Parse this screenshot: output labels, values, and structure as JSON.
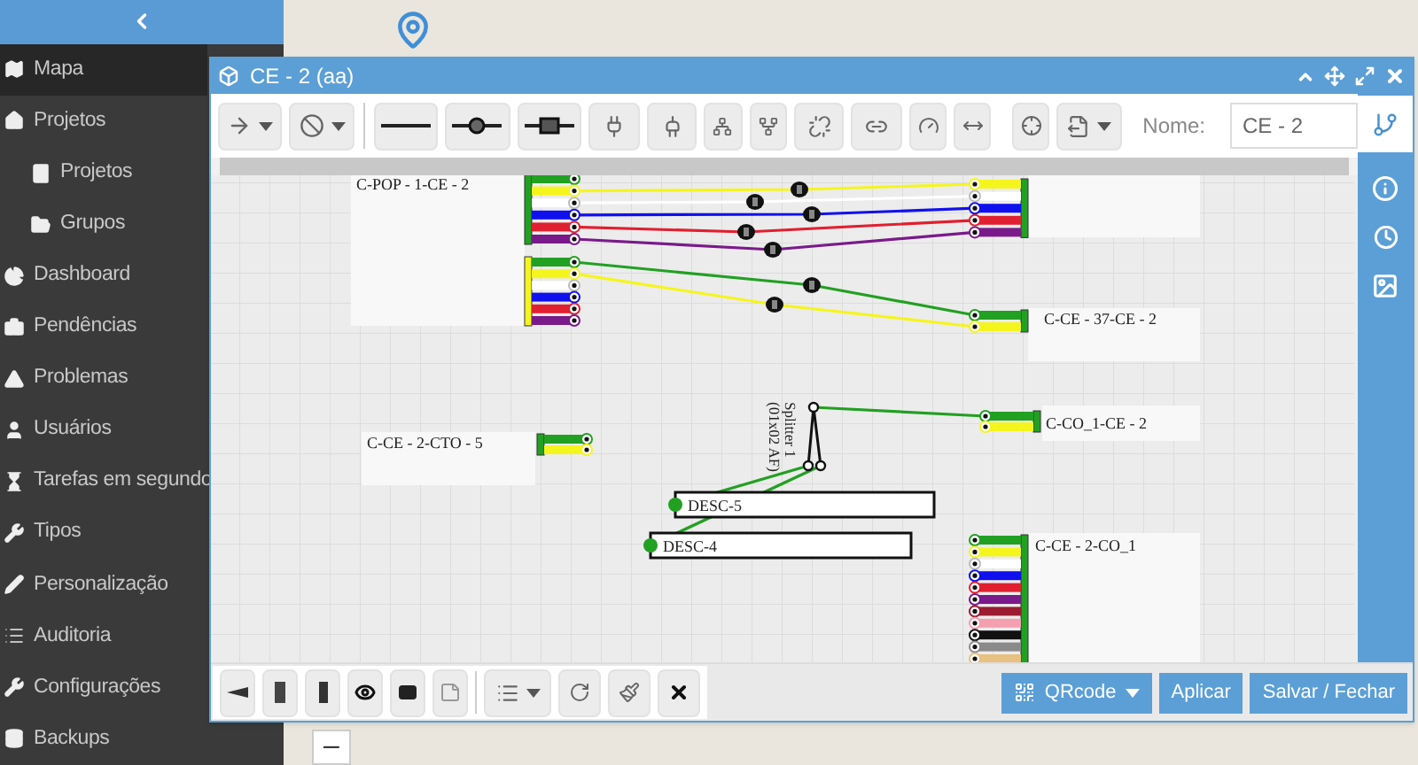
{
  "sidebar": {
    "items": [
      {
        "label": "Mapa",
        "selected": true
      },
      {
        "label": "Projetos",
        "selected": false,
        "children": [
          {
            "label": "Projetos",
            "selected": false
          },
          {
            "label": "Grupos",
            "selected": false
          }
        ]
      },
      {
        "label": "Dashboard",
        "selected": false
      },
      {
        "label": "Pendências",
        "selected": false
      },
      {
        "label": "Problemas",
        "selected": false
      },
      {
        "label": "Usuários",
        "selected": false
      },
      {
        "label": "Tarefas em segundo",
        "selected": false
      },
      {
        "label": "Tipos",
        "selected": false
      },
      {
        "label": "Personalização",
        "selected": false
      },
      {
        "label": "Auditoria",
        "selected": false
      },
      {
        "label": "Configurações",
        "selected": false
      },
      {
        "label": "Backups",
        "selected": false
      }
    ]
  },
  "map": {
    "zoom_control": "–"
  },
  "window": {
    "title": "CE - 2 (aa)",
    "name_label": "Nome:",
    "name_value": "CE - 2",
    "diagram": {
      "cables": [
        {
          "label": "C-POP - 1-CE - 2",
          "color": "#22a022",
          "fibers": [
            {
              "color": "#22a022"
            },
            {
              "color": "#f5f51e"
            },
            {
              "color": "#ffffff"
            },
            {
              "color": "#1010ee"
            },
            {
              "color": "#e02030"
            },
            {
              "color": "#7a1a8a"
            }
          ]
        },
        {
          "color": "#f5f51e",
          "fibers": [
            {
              "color": "#22a022"
            },
            {
              "color": "#f5f51e"
            },
            {
              "color": "#ffffff"
            },
            {
              "color": "#1010ee"
            },
            {
              "color": "#e02030"
            },
            {
              "color": "#7a1a8a"
            }
          ]
        },
        {
          "color": "#22a022",
          "fibers": [
            {
              "color": "#f5f51e"
            },
            {
              "color": "#ffffff"
            },
            {
              "color": "#1010ee"
            },
            {
              "color": "#e02030"
            },
            {
              "color": "#7a1a8a"
            }
          ]
        },
        {
          "label": "C-CE - 37-CE - 2",
          "color": "#22a022",
          "fibers": [
            {
              "color": "#22a022"
            },
            {
              "color": "#f5f51e"
            }
          ]
        },
        {
          "label": "C-CE - 2-CTO - 5",
          "color": "#22a022",
          "fibers": [
            {
              "color": "#22a022"
            },
            {
              "color": "#f5f51e"
            }
          ]
        },
        {
          "label": "C-CO_1-CE - 2",
          "color": "#22a022",
          "fibers": [
            {
              "color": "#22a022"
            },
            {
              "color": "#f5f51e"
            }
          ]
        },
        {
          "label": "C-CE - 2-CO_1",
          "color": "#22a022",
          "fibers": [
            {
              "color": "#22a022"
            },
            {
              "color": "#f5f51e"
            },
            {
              "color": "#ffffff"
            },
            {
              "color": "#1010ee"
            },
            {
              "color": "#e02030"
            },
            {
              "color": "#7a1a8a"
            },
            {
              "color": "#9b1b30"
            },
            {
              "color": "#f4a0b0"
            },
            {
              "color": "#111111"
            },
            {
              "color": "#8a8a8a"
            },
            {
              "color": "#e8c080"
            }
          ]
        }
      ],
      "splitter": {
        "label_lines": [
          "Splitter 1",
          "(01x02 AF)"
        ]
      },
      "terminals": [
        {
          "label": "DESC-5"
        },
        {
          "label": "DESC-4"
        }
      ]
    },
    "footer_buttons": [
      {
        "label": "QRcode",
        "kind": "dropdown"
      },
      {
        "label": "Aplicar",
        "kind": "plain"
      },
      {
        "label": "Salvar / Fechar",
        "kind": "plain"
      }
    ]
  }
}
